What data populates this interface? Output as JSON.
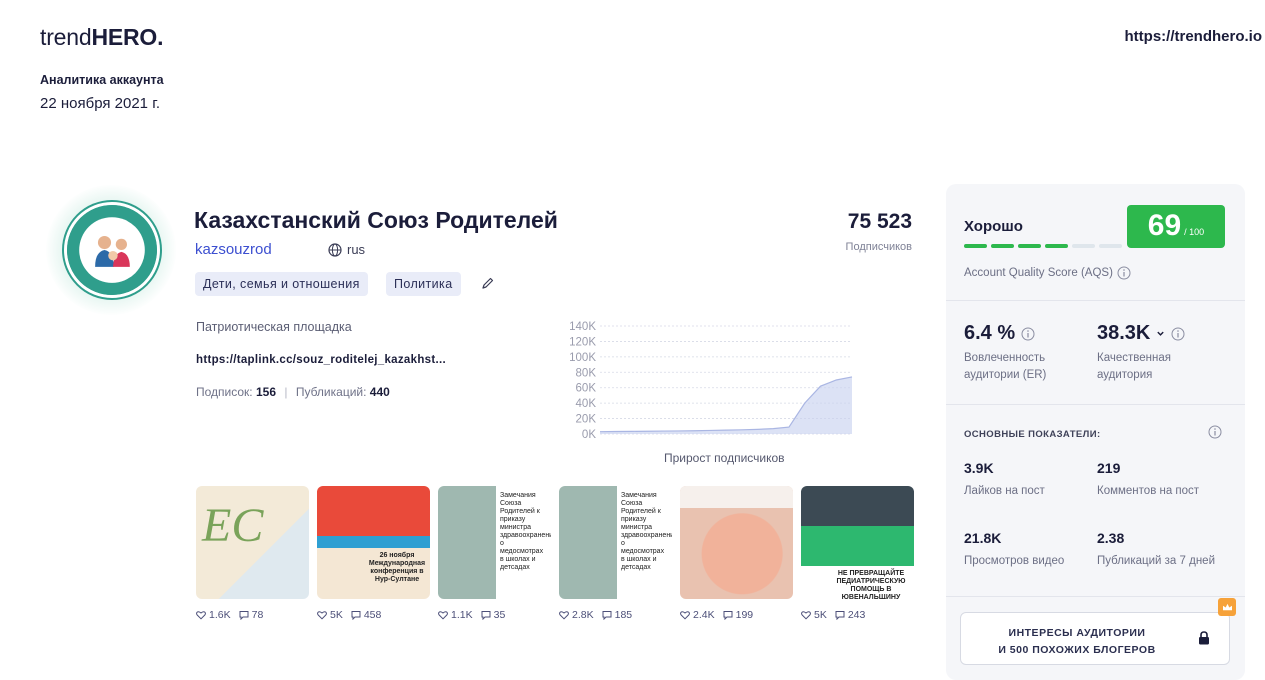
{
  "header": {
    "logo_light": "trend",
    "logo_bold": "HERO.",
    "site_url": "https://trendhero.io",
    "report_title": "Аналитика аккаунта",
    "report_date": "22 ноября 2021 г."
  },
  "account": {
    "name": "Казахстанский Союз Родителей",
    "handle": "kazsouzrod",
    "language": "rus",
    "tags": [
      "Дети, семья и отношения",
      "Политика"
    ],
    "followers": "75 523",
    "followers_label": "Подписчиков",
    "description": "Патриотическая площадка",
    "link": "https://taplink.cc/souz_roditelej_kazakhst...",
    "following_label": "Подписок:",
    "following": "156",
    "posts_label": "Публикаций:",
    "posts": "440",
    "avatar_icon": "family-logo-icon"
  },
  "chart_data": {
    "type": "area",
    "title": "",
    "xlabel": "Прирост подписчиков",
    "ylabel": "",
    "y_tick_labels": [
      "0K",
      "20K",
      "40K",
      "60K",
      "80K",
      "100K",
      "120K",
      "140K"
    ],
    "ylim": [
      0,
      140000
    ],
    "x": [
      0,
      1,
      2,
      3,
      4,
      5,
      6,
      7,
      8,
      9,
      10,
      11,
      12,
      13,
      14,
      15,
      16
    ],
    "values": [
      3000,
      3200,
      3400,
      3600,
      3800,
      4000,
      4200,
      4600,
      5000,
      5400,
      6000,
      7000,
      9000,
      40000,
      62000,
      70000,
      74000
    ],
    "grid": true,
    "color": "#c9d2ef"
  },
  "posts": [
    {
      "likes": "1.6K",
      "comments": "78",
      "palette": [
        "#f3ead8",
        "#7aa35a"
      ],
      "text": ""
    },
    {
      "likes": "5K",
      "comments": "458",
      "palette": [
        "#e94a3a",
        "#2e9fd2"
      ],
      "text": "26 ноября Международная конференция в Нур-Султане"
    },
    {
      "likes": "1.1K",
      "comments": "35",
      "palette": [
        "#9fb8b0",
        "#ffffff"
      ],
      "text": "Замечания Союза Родителей к приказу министра здравоохранения о медосмотрах в школах и детсадах"
    },
    {
      "likes": "2.8K",
      "comments": "185",
      "palette": [
        "#9fb8b0",
        "#ffffff"
      ],
      "text": "Замечания Союза Родителей к приказу министра здравоохранения о медосмотрах в школах и детсадах"
    },
    {
      "likes": "2.4K",
      "comments": "199",
      "palette": [
        "#f1b29a",
        "#d8432f"
      ],
      "text": ""
    },
    {
      "likes": "5K",
      "comments": "243",
      "palette": [
        "#3c4a54",
        "#2db86f"
      ],
      "text": "НЕ ПРЕВРАЩАЙТЕ ПЕДИАТРИЧЕСКУЮ ПОМОЩЬ В ЮВЕНАЛЬЩИНУ"
    }
  ],
  "panel": {
    "quality_label": "Хорошо",
    "quality_bar_filled": 4,
    "quality_bar_total": 6,
    "score": "69",
    "score_max": "/ 100",
    "aqs_label": "Account Quality Score (AQS)",
    "er_value": "6.4 %",
    "er_label": "Вовлеченность аудитории (ER)",
    "qa_value": "38.3K",
    "qa_label": "Качественная аудитория",
    "section_title": "ОСНОВНЫЕ ПОКАЗАТЕЛИ:",
    "kpis": [
      {
        "value": "3.9K",
        "label": "Лайков на пост"
      },
      {
        "value": "219",
        "label": "Комментов на пост"
      },
      {
        "value": "21.8K",
        "label": "Просмотров видео"
      },
      {
        "value": "2.38",
        "label": "Публикаций за 7 дней"
      }
    ],
    "cta_line1": "ИНТЕРЕСЫ АУДИТОРИИ",
    "cta_line2": "И 500 ПОХОЖИХ БЛОГЕРОВ"
  },
  "colors": {
    "accent_green": "#2db84d",
    "link_blue": "#3c4fd0",
    "tag_bg": "#e9ecf8",
    "crown_orange": "#f6a23a"
  }
}
